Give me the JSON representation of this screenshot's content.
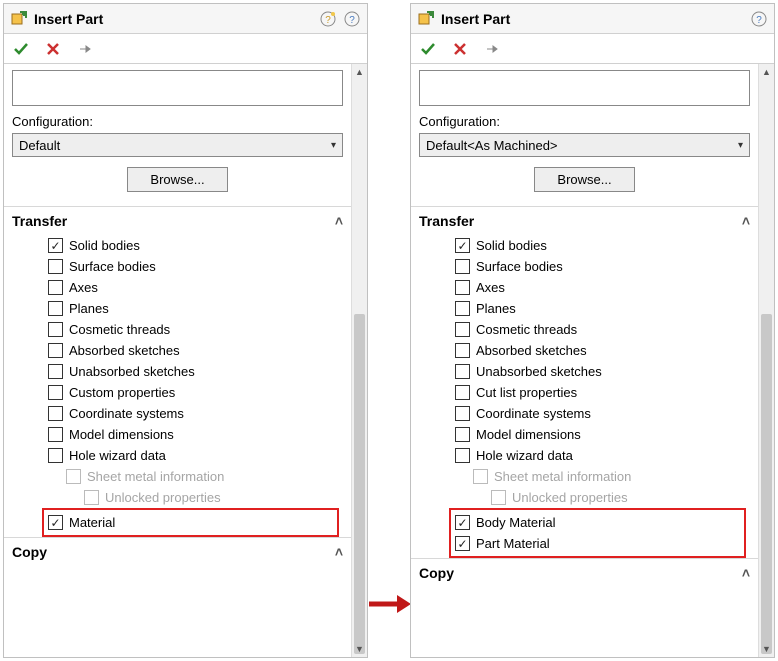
{
  "leftPanel": {
    "title": "Insert Part",
    "configLabel": "Configuration:",
    "configValue": "Default",
    "browseLabel": "Browse...",
    "transferHeader": "Transfer",
    "checks": {
      "solid": "Solid bodies",
      "surface": "Surface bodies",
      "axes": "Axes",
      "planes": "Planes",
      "cosmetic": "Cosmetic threads",
      "absorbed": "Absorbed sketches",
      "unabsorbed": "Unabsorbed sketches",
      "custom": "Custom properties",
      "coord": "Coordinate systems",
      "modeldim": "Model dimensions",
      "holewiz": "Hole wizard data",
      "sheetmetal": "Sheet metal information",
      "unlocked": "Unlocked properties",
      "material": "Material"
    },
    "copyHeader": "Copy"
  },
  "rightPanel": {
    "title": "Insert Part",
    "configLabel": "Configuration:",
    "configValue": "Default<As Machined>",
    "browseLabel": "Browse...",
    "transferHeader": "Transfer",
    "checks": {
      "solid": "Solid bodies",
      "surface": "Surface bodies",
      "axes": "Axes",
      "planes": "Planes",
      "cosmetic": "Cosmetic threads",
      "absorbed": "Absorbed sketches",
      "unabsorbed": "Unabsorbed sketches",
      "cutlist": "Cut list properties",
      "coord": "Coordinate systems",
      "modeldim": "Model dimensions",
      "holewiz": "Hole wizard data",
      "sheetmetal": "Sheet metal information",
      "unlocked": "Unlocked properties",
      "bodymat": "Body Material",
      "partmat": "Part Material"
    },
    "copyHeader": "Copy"
  }
}
